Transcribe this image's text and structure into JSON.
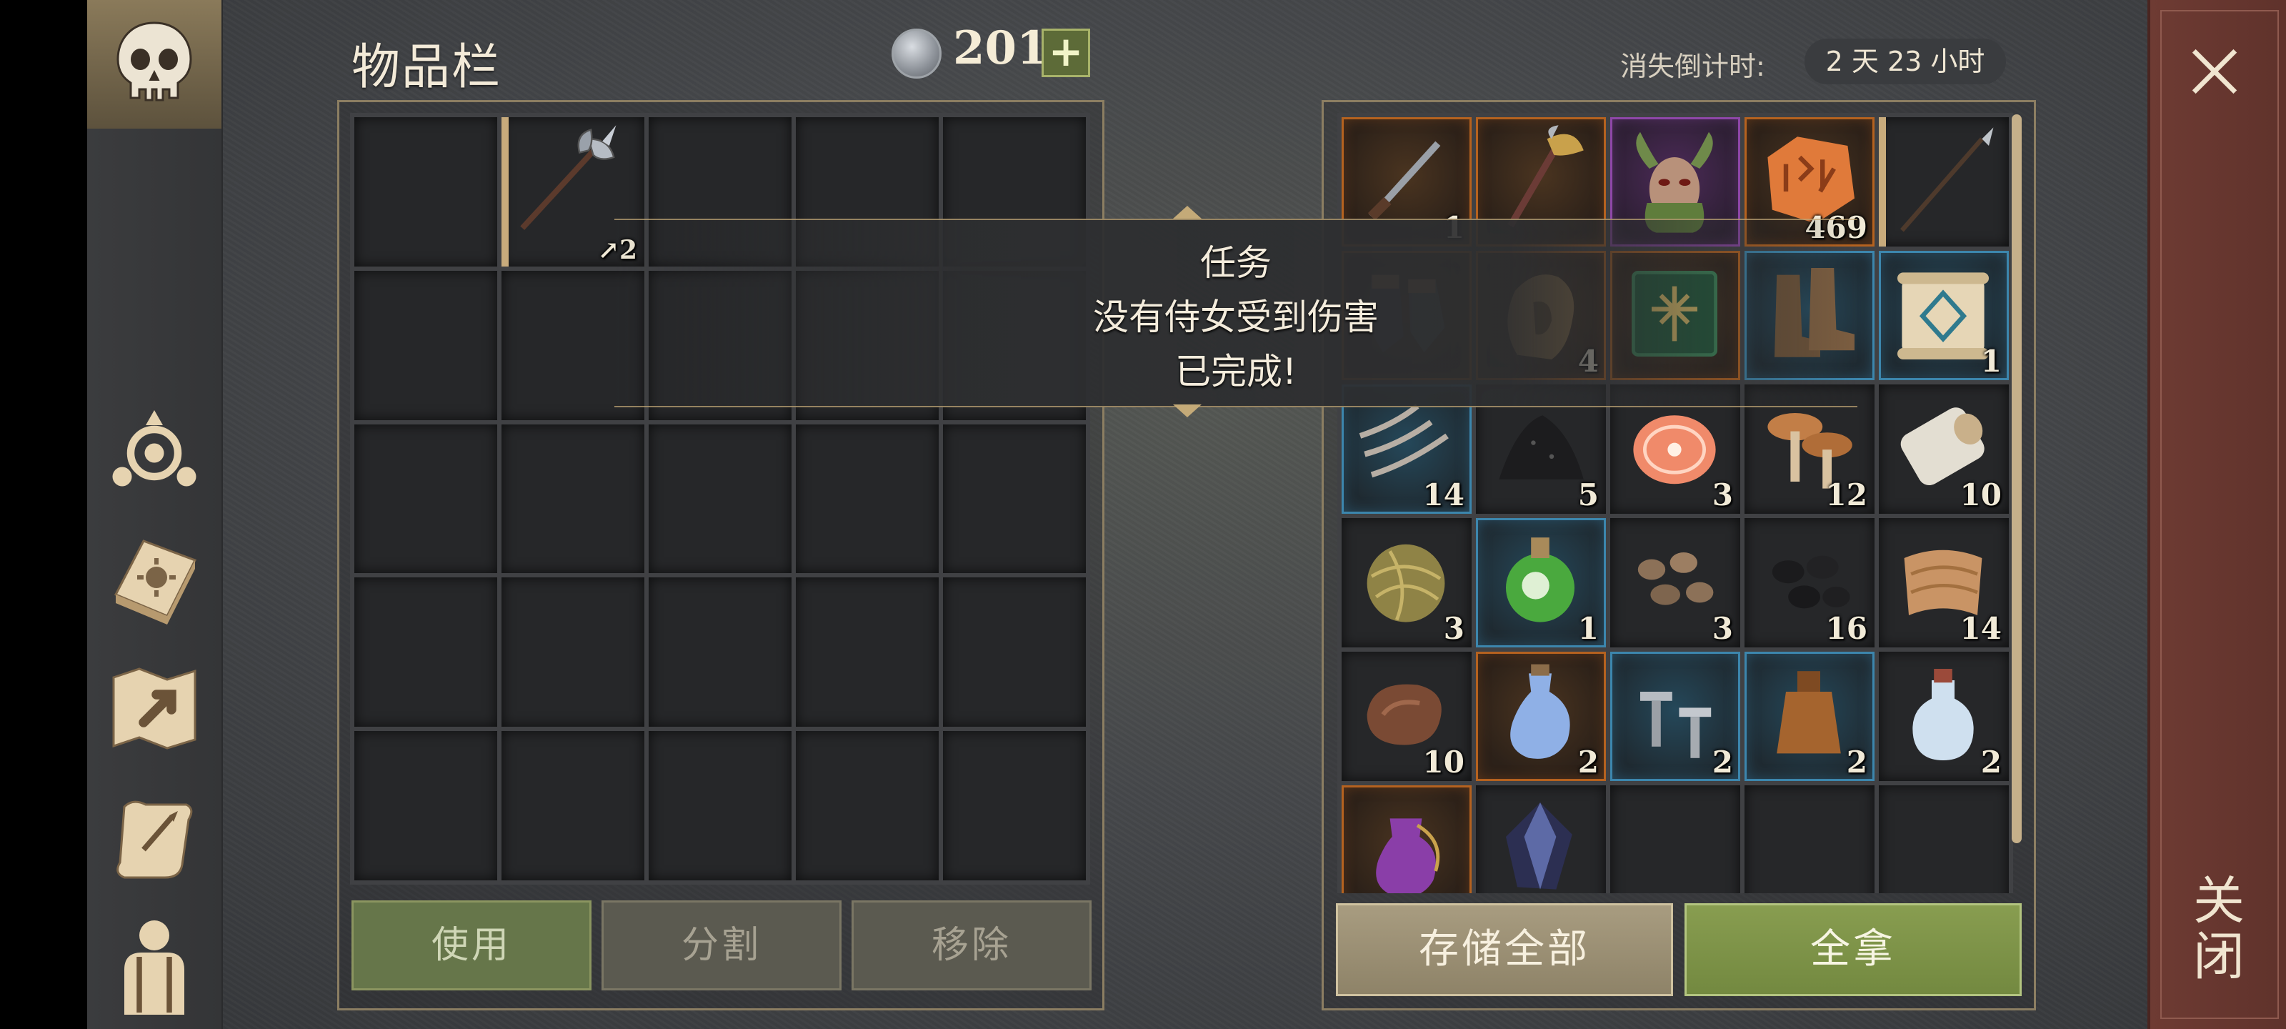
{
  "header": {
    "title": "物品栏",
    "currency_amount": "201",
    "currency_plus": "+",
    "countdown_label": "消失倒计时:",
    "countdown_value": "2 天 23 小时"
  },
  "close": {
    "label": "关闭"
  },
  "nav": {
    "items": [
      "skull-icon",
      "clan-icon",
      "recipe-book-icon",
      "map-icon",
      "quests-scroll-icon",
      "character-icon"
    ]
  },
  "inventory": {
    "rows_visible": 5,
    "columns": 5,
    "items": [
      {
        "slot": 1,
        "icon": "halberd-icon",
        "quantity": "2",
        "durability_marker": "↗"
      }
    ],
    "buttons": {
      "use": "使用",
      "split": "分割",
      "remove": "移除"
    }
  },
  "loot": {
    "items": [
      {
        "icon": "dagger-icon",
        "rarity": "orange",
        "quantity": "1"
      },
      {
        "icon": "axe-icon",
        "rarity": "orange",
        "quantity": ""
      },
      {
        "icon": "demon-mask-icon",
        "rarity": "purple",
        "quantity": ""
      },
      {
        "icon": "rune-stone-icon",
        "rarity": "orange",
        "quantity": "469"
      },
      {
        "icon": "spear-icon",
        "rarity": "tan",
        "quantity": ""
      },
      {
        "icon": "gauntlets-icon",
        "rarity": "orange",
        "quantity": ""
      },
      {
        "icon": "leather-hood-icon",
        "rarity": "orange",
        "quantity": "4"
      },
      {
        "icon": "green-tome-icon",
        "rarity": "orange",
        "quantity": ""
      },
      {
        "icon": "boots-icon",
        "rarity": "blue",
        "quantity": ""
      },
      {
        "icon": "rune-scroll-icon",
        "rarity": "blue",
        "quantity": "1"
      },
      {
        "icon": "claw-hooks-icon",
        "rarity": "blue",
        "quantity": "14"
      },
      {
        "icon": "coal-pile-icon",
        "rarity": "none",
        "quantity": "5"
      },
      {
        "icon": "salmon-steak-icon",
        "rarity": "none",
        "quantity": "3"
      },
      {
        "icon": "mushrooms-icon",
        "rarity": "none",
        "quantity": "12"
      },
      {
        "icon": "birch-log-icon",
        "rarity": "none",
        "quantity": "10"
      },
      {
        "icon": "fiber-ball-icon",
        "rarity": "none",
        "quantity": "3"
      },
      {
        "icon": "green-potion-icon",
        "rarity": "blue",
        "quantity": "1"
      },
      {
        "icon": "stones-icon",
        "rarity": "none",
        "quantity": "3"
      },
      {
        "icon": "coal-icon",
        "rarity": "none",
        "quantity": "16"
      },
      {
        "icon": "cloth-icon",
        "rarity": "none",
        "quantity": "14"
      },
      {
        "icon": "leather-icon",
        "rarity": "none",
        "quantity": "10"
      },
      {
        "icon": "blue-crystal-flask-icon",
        "rarity": "orange",
        "quantity": "2"
      },
      {
        "icon": "nails-icon",
        "rarity": "blue",
        "quantity": "2"
      },
      {
        "icon": "leather-flask-icon",
        "rarity": "blue",
        "quantity": "2"
      },
      {
        "icon": "water-bottle-icon",
        "rarity": "none",
        "quantity": "2"
      },
      {
        "icon": "purple-potion-icon",
        "rarity": "orange",
        "quantity": ""
      },
      {
        "icon": "dark-crystal-icon",
        "rarity": "none",
        "quantity": ""
      },
      {
        "icon": "",
        "rarity": "none",
        "quantity": ""
      },
      {
        "icon": "",
        "rarity": "none",
        "quantity": ""
      },
      {
        "icon": "",
        "rarity": "none",
        "quantity": ""
      }
    ],
    "buttons": {
      "store_all": "存储全部",
      "take_all": "全拿"
    }
  },
  "notification": {
    "title": "任务",
    "message": "没有侍女受到伤害",
    "status": "已完成!"
  },
  "colors": {
    "rarity_orange": "#b5621f",
    "rarity_blue": "#3c86ad",
    "rarity_purple": "#8e47a8",
    "take_all_green": "#7a8f46",
    "use_green": "#66764a",
    "close_red": "#6e3b33"
  }
}
